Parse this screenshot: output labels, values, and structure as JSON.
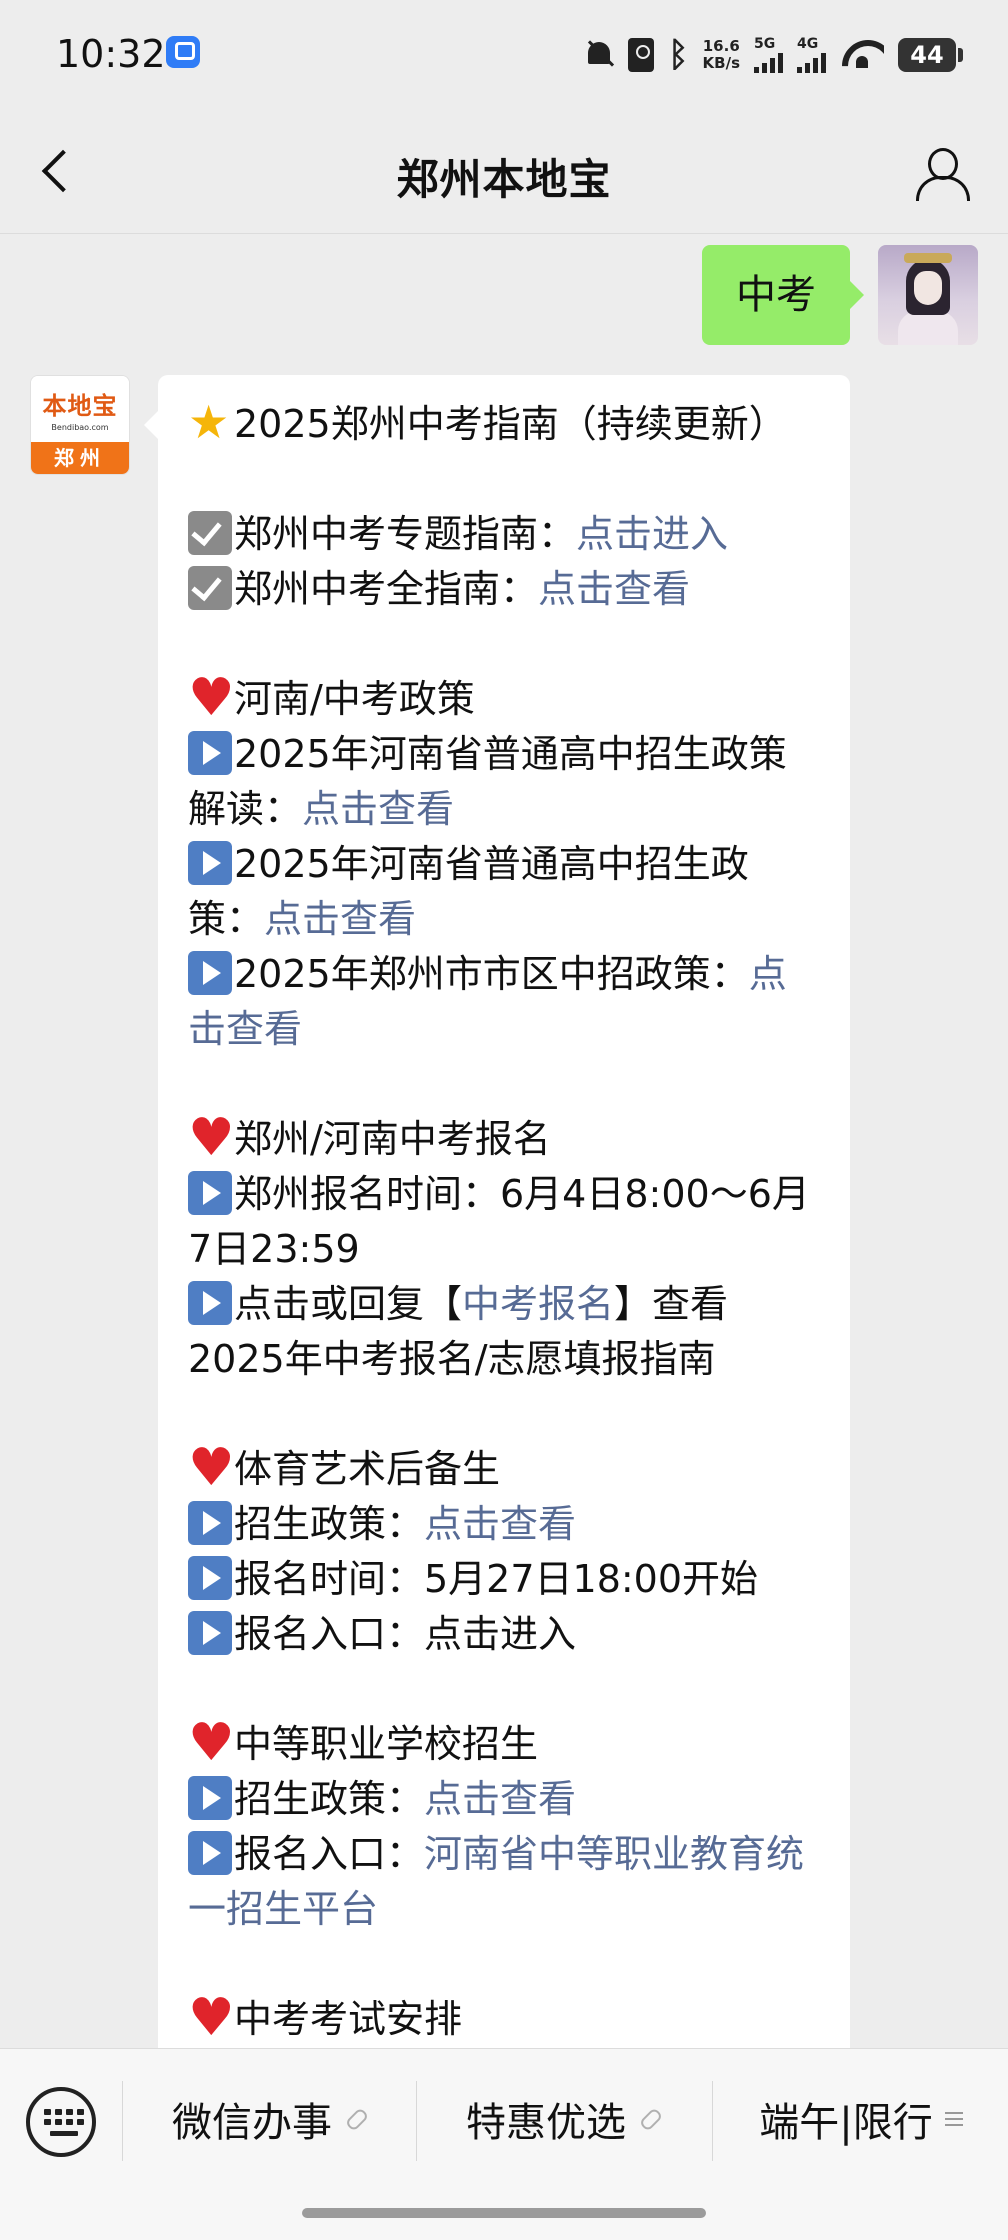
{
  "status_bar": {
    "time": "10:32",
    "network_speed_value": "16.6",
    "network_speed_unit": "KB/s",
    "sig1_label": "5G",
    "sig2_label": "4G",
    "battery": "44",
    "icons": [
      "ai-assistant-icon",
      "mute-bell-icon",
      "sim-icon",
      "bluetooth-icon",
      "signal-5g-icon",
      "signal-4g-icon",
      "wifi-icon",
      "battery-icon"
    ]
  },
  "header": {
    "title": "郑州本地宝"
  },
  "chat": {
    "outgoing_message": "中考",
    "avatar_brand_top": "本地宝",
    "avatar_brand_url": "Bendibao.com",
    "avatar_brand_city": "郑州",
    "message_lines": [
      {
        "emoji": "star",
        "text": "2025郑州中考指南（持续更新）"
      },
      {
        "gap": true
      },
      {
        "emoji": "check",
        "text": "郑州中考专题指南：",
        "link": "点击进入"
      },
      {
        "emoji": "check",
        "text": "郑州中考全指南：",
        "link": "点击查看"
      },
      {
        "gap": true
      },
      {
        "emoji": "heart",
        "text": "河南/中考政策"
      },
      {
        "emoji": "play",
        "text": "2025年河南省普通高中招生政策解读：",
        "link": "点击查看"
      },
      {
        "emoji": "play",
        "text": "2025年河南省普通高中招生政策：",
        "link": "点击查看"
      },
      {
        "emoji": "play",
        "text": "2025年郑州市市区中招政策：",
        "link": "点击查看"
      },
      {
        "gap": true
      },
      {
        "emoji": "heart",
        "text": "郑州/河南中考报名"
      },
      {
        "emoji": "play",
        "text": "郑州报名时间：6月4日8:00～6月7日23:59"
      },
      {
        "emoji": "play",
        "text": "点击或回复【",
        "link": "中考报名",
        "after": "】查看2025年中考报名/志愿填报指南"
      },
      {
        "gap": true
      },
      {
        "emoji": "heart",
        "text": "体育艺术后备生"
      },
      {
        "emoji": "play",
        "text": "招生政策：",
        "link": "点击查看"
      },
      {
        "emoji": "play",
        "text": "报名时间：5月27日18:00开始"
      },
      {
        "emoji": "play",
        "text": "报名入口：点击进入"
      },
      {
        "gap": true
      },
      {
        "emoji": "heart",
        "text": "中等职业学校招生"
      },
      {
        "emoji": "play",
        "text": "招生政策：",
        "link": "点击查看"
      },
      {
        "emoji": "play",
        "text": "报名入口：",
        "link": "河南省中等职业教育统一招生平台"
      },
      {
        "gap": true
      },
      {
        "emoji": "heart",
        "text": "中考考试安排"
      }
    ],
    "colors": {
      "link": "#576b95",
      "outgoing_bubble": "#95ec69",
      "background": "#ededed"
    }
  },
  "bottom_menu": {
    "items": [
      {
        "label": "微信办事",
        "icon": "link-icon"
      },
      {
        "label": "特惠优选",
        "icon": "link-icon"
      },
      {
        "label": "端午|限行",
        "icon": "menu-list-icon"
      }
    ]
  }
}
